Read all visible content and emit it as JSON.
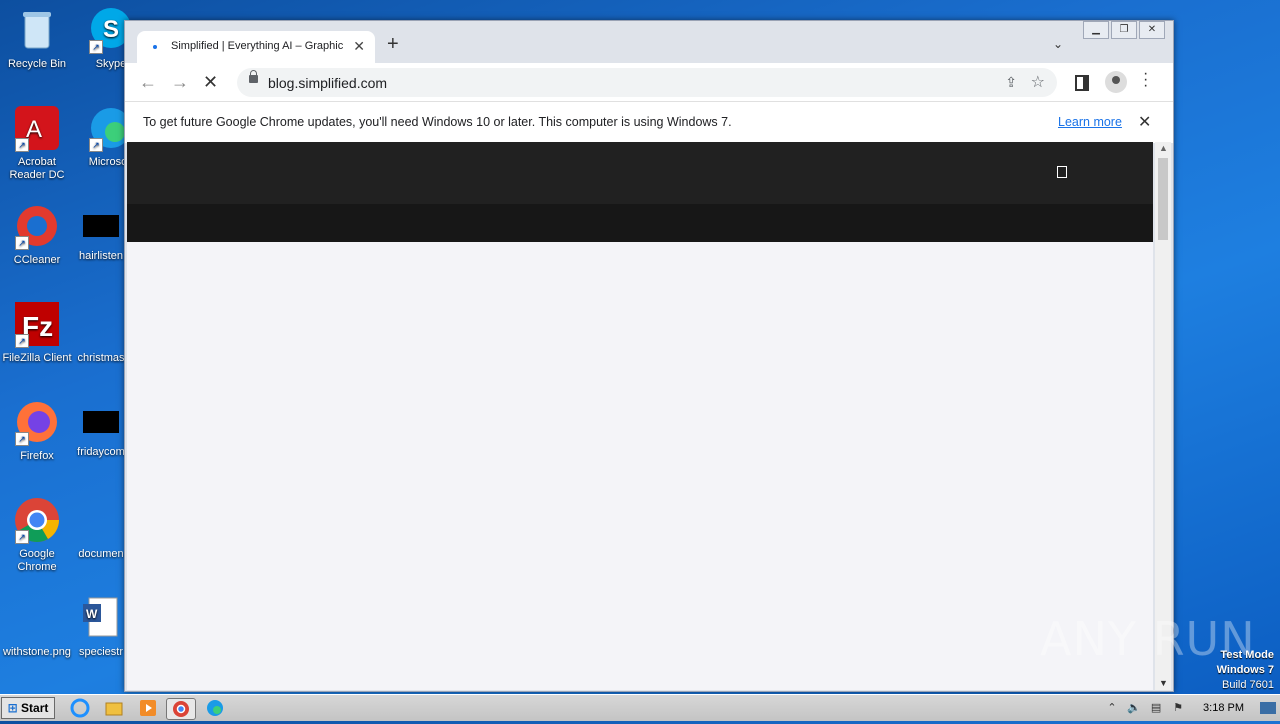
{
  "desktop": {
    "icons": [
      {
        "label": "Recycle Bin"
      },
      {
        "label": "Skype"
      },
      {
        "label": "Acrobat Reader DC"
      },
      {
        "label": "Microsoft"
      },
      {
        "label": "CCleaner"
      },
      {
        "label": "hairlisten"
      },
      {
        "label": "FileZilla Client"
      },
      {
        "label": "christmas"
      },
      {
        "label": "Firefox"
      },
      {
        "label": "fridaycom"
      },
      {
        "label": "Google Chrome"
      },
      {
        "label": "documen"
      },
      {
        "label": "withstone.png"
      },
      {
        "label": "speciestr"
      }
    ],
    "watermark": "ANY RUN",
    "test_mode": {
      "line1": "Test Mode",
      "line2": "Windows 7",
      "line3": "Build 7601"
    }
  },
  "browser": {
    "tab_title": "Simplified | Everything AI – Graphic D",
    "url": "blog.simplified.com",
    "infobar_message": "To get future Google Chrome updates, you'll need Windows 10 or later. This computer is using Windows 7.",
    "infobar_link": "Learn more"
  },
  "taskbar": {
    "start_label": "Start",
    "clock": "3:18 PM"
  },
  "colors": {
    "accent": "#1a73e8",
    "page_header": "#212121",
    "page_bg": "#f4f4f8"
  }
}
